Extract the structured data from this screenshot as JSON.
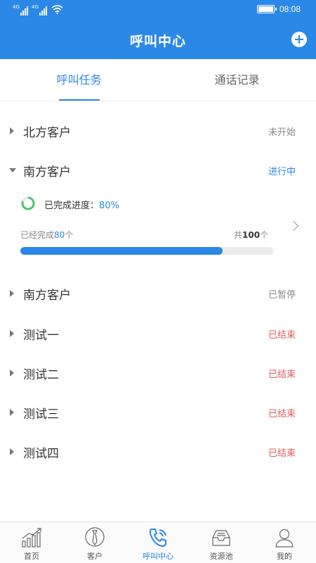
{
  "status_bar": {
    "signal_1_label": "4G",
    "signal_2_label": "4G",
    "time": "08:08"
  },
  "header": {
    "title": "呼叫中心",
    "add_icon": "plus-circle-icon"
  },
  "tabs": [
    {
      "label": "呼叫任务",
      "active": true
    },
    {
      "label": "通话记录",
      "active": false
    }
  ],
  "tasks": [
    {
      "name": "北方客户",
      "status": "未开始",
      "status_color": "#8a8a8a",
      "expanded": false
    },
    {
      "name": "南方客户",
      "status": "进行中",
      "status_color": "#2b88e6",
      "expanded": true
    },
    {
      "name": "南方客户",
      "status": "已暂停",
      "status_color": "#8a8a8a",
      "expanded": false
    },
    {
      "name": "测试一",
      "status": "已结束",
      "status_color": "#e35a5a",
      "expanded": false
    },
    {
      "name": "测试二",
      "status": "已结束",
      "status_color": "#e35a5a",
      "expanded": false
    },
    {
      "name": "测试三",
      "status": "已结束",
      "status_color": "#e35a5a",
      "expanded": false
    },
    {
      "name": "测试四",
      "status": "已结束",
      "status_color": "#e35a5a",
      "expanded": false
    }
  ],
  "expanded_detail": {
    "progress_prefix": "已完成进度：",
    "progress_percent": "80%",
    "progress_fraction": 0.8,
    "done_prefix": "已经完成",
    "done_count": "80",
    "done_suffix": "个",
    "total_prefix": "共",
    "total_count": "100",
    "total_suffix": "个"
  },
  "bottom_nav": [
    {
      "label": "首页",
      "icon": "chart-growth-icon",
      "active": false
    },
    {
      "label": "客户",
      "icon": "customer-tie-icon",
      "active": false
    },
    {
      "label": "呼叫中心",
      "icon": "phone-icon",
      "active": true
    },
    {
      "label": "资源池",
      "icon": "inbox-tray-icon",
      "active": false
    },
    {
      "label": "我的",
      "icon": "user-icon",
      "active": false
    }
  ],
  "colors": {
    "brand": "#2b88e6",
    "ended": "#e35a5a",
    "muted": "#8a8a8a"
  }
}
